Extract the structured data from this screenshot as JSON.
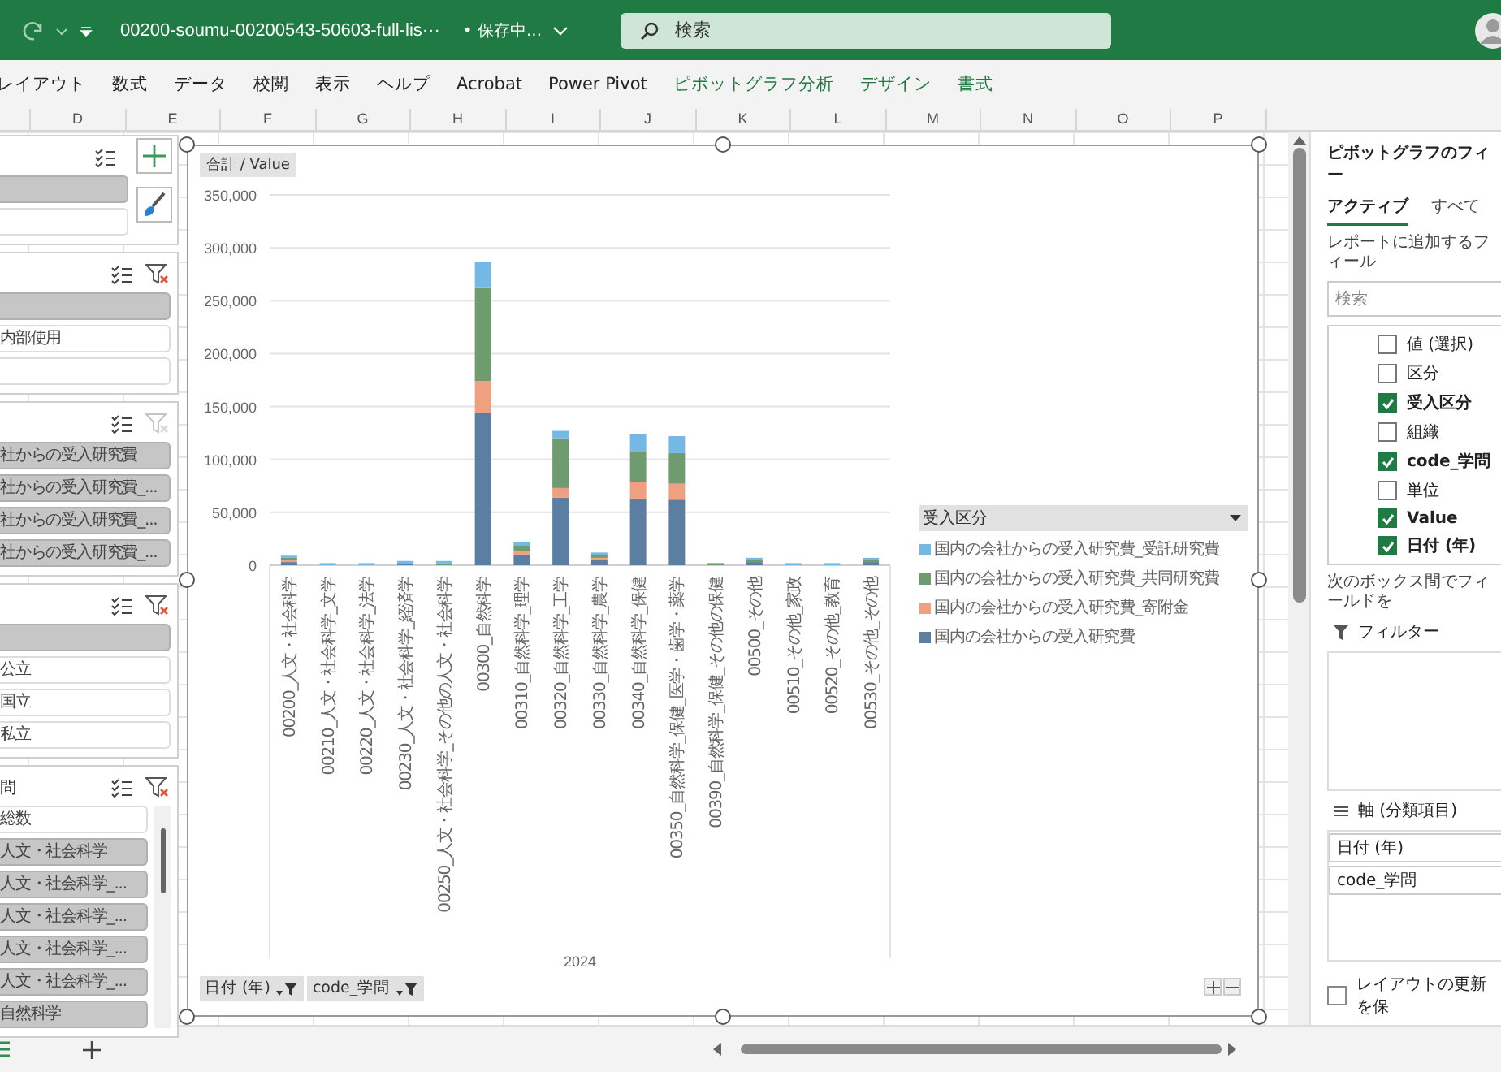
{
  "title_bar": {
    "file_name": "00200-soumu-00200543-50603-full-lis···",
    "save_status": "• 保存中...",
    "search_placeholder": "検索"
  },
  "ribbon_tabs": [
    {
      "label": "レイアウト",
      "kind": "normal"
    },
    {
      "label": "数式",
      "kind": "normal"
    },
    {
      "label": "データ",
      "kind": "normal"
    },
    {
      "label": "校閲",
      "kind": "normal"
    },
    {
      "label": "表示",
      "kind": "normal"
    },
    {
      "label": "ヘルプ",
      "kind": "normal"
    },
    {
      "label": "Acrobat",
      "kind": "normal"
    },
    {
      "label": "Power Pivot",
      "kind": "normal"
    },
    {
      "label": "ピボットグラフ分析",
      "kind": "contextual"
    },
    {
      "label": "デザイン",
      "kind": "contextual"
    },
    {
      "label": "書式",
      "kind": "contextual"
    }
  ],
  "columns": [
    "D",
    "E",
    "F",
    "G",
    "H",
    "I",
    "J",
    "K",
    "L",
    "M",
    "N",
    "O",
    "P"
  ],
  "slicers": [
    {
      "kind": "tools",
      "items": [
        {
          "selected": true
        },
        {
          "selected": false
        }
      ]
    },
    {
      "kind": "plain",
      "filter_active": true,
      "items": [
        {
          "selected": true
        },
        {
          "label": "内部使用",
          "selected": false
        },
        {
          "selected": false
        }
      ]
    },
    {
      "kind": "plain",
      "filter_active": false,
      "items": [
        {
          "label": "社からの受入研究費",
          "selected": true
        },
        {
          "label": "社からの受入研究費_...",
          "selected": true
        },
        {
          "label": "社からの受入研究費_...",
          "selected": true
        },
        {
          "label": "社からの受入研究費_...",
          "selected": true
        }
      ]
    },
    {
      "kind": "plain",
      "filter_active": true,
      "items": [
        {
          "selected": true
        },
        {
          "label": "公立",
          "selected": false
        },
        {
          "label": "国立",
          "selected": false
        },
        {
          "label": "私立",
          "selected": false
        }
      ]
    },
    {
      "kind": "scroll",
      "header": "問",
      "filter_active": true,
      "items": [
        {
          "label": "総数",
          "selected": false
        },
        {
          "label": "人文・社会科学",
          "selected": true
        },
        {
          "label": "人文・社会科学_...",
          "selected": true
        },
        {
          "label": "人文・社会科学_...",
          "selected": true
        },
        {
          "label": "人文・社会科学_...",
          "selected": true
        },
        {
          "label": "人文・社会科学_...",
          "selected": true
        },
        {
          "label": "自然科学",
          "selected": true
        }
      ]
    }
  ],
  "pivot_chart": {
    "value_field_button": "合計 / Value",
    "legend_title": "受入区分",
    "axis_field_buttons": [
      "日付 (年)",
      "code_学問"
    ],
    "chart_data": {
      "type": "bar",
      "stacked": true,
      "orientation": "vertical",
      "grid": true,
      "legend": true,
      "xlabel": "2024",
      "categories": [
        "00200_人文・社会科学",
        "00210_人文・社会科学_文学",
        "00220_人文・社会科学_法学",
        "00230_人文・社会科学_経済学",
        "00250_人文・社会科学_その他の人文・社会科学",
        "00300_自然科学",
        "00310_自然科学_理学",
        "00320_自然科学_工学",
        "00330_自然科学_農学",
        "00340_自然科学_保健",
        "00350_自然科学_保健_医学・歯学・薬学",
        "00390_自然科学_保健_その他の保健",
        "00500_その他",
        "00510_その他_家政",
        "00520_その他_教育",
        "00530_その他_その他"
      ],
      "series": [
        {
          "name": "国内の会社からの受入研究費",
          "color": "#5b7fa3",
          "values": [
            3000,
            0,
            0,
            2000,
            0,
            144000,
            10000,
            64000,
            5000,
            63000,
            62000,
            0,
            3000,
            0,
            0,
            3000
          ]
        },
        {
          "name": "国内の会社からの受入研究費_寄附金",
          "color": "#f0a080",
          "values": [
            2000,
            0,
            0,
            0,
            0,
            30000,
            3000,
            9000,
            2000,
            16000,
            15000,
            0,
            0,
            0,
            0,
            0
          ]
        },
        {
          "name": "国内の会社からの受入研究費_共同研究費",
          "color": "#6e9c6e",
          "values": [
            2000,
            0,
            0,
            0,
            2000,
            88000,
            6000,
            47000,
            3000,
            29000,
            29000,
            2000,
            2000,
            0,
            0,
            2000
          ]
        },
        {
          "name": "国内の会社からの受入研究費_受託研究費",
          "color": "#74b8e6",
          "values": [
            2000,
            2000,
            2000,
            2000,
            2000,
            25000,
            3000,
            7000,
            2000,
            16000,
            16000,
            0,
            2000,
            2000,
            2000,
            2000
          ]
        }
      ],
      "ylim": [
        0,
        350000
      ],
      "yticks": [
        {
          "value": 0,
          "label": "0"
        },
        {
          "value": 50000,
          "label": "50,000"
        },
        {
          "value": 100000,
          "label": "100,000"
        },
        {
          "value": 150000,
          "label": "150,000"
        },
        {
          "value": 200000,
          "label": "200,000"
        },
        {
          "value": 250000,
          "label": "250,000"
        },
        {
          "value": 300000,
          "label": "300,000"
        },
        {
          "value": 350000,
          "label": "350,000"
        }
      ]
    }
  },
  "field_pane": {
    "title": "ピボットグラフのフィー",
    "tabs": [
      {
        "label": "アクティブ",
        "selected": true
      },
      {
        "label": "すべて",
        "selected": false
      }
    ],
    "instruction": "レポートに追加するフィール",
    "search_placeholder": "検索",
    "fields": [
      {
        "label": "値 (選択)",
        "checked": false
      },
      {
        "label": "区分",
        "checked": false
      },
      {
        "label": "受入区分",
        "checked": true
      },
      {
        "label": "組織",
        "checked": false
      },
      {
        "label": "code_学問",
        "checked": true
      },
      {
        "label": "単位",
        "checked": false
      },
      {
        "label": "Value",
        "checked": true
      },
      {
        "label": "日付 (年)",
        "checked": true
      }
    ],
    "areas_hint": "次のボックス間でフィールドを",
    "filter_area": "フィルター",
    "axis_area": {
      "label": "軸 (分類項目)",
      "items": [
        "日付 (年)",
        "code_学問"
      ]
    },
    "defer_update": {
      "label": "レイアウトの更新を保",
      "checked": false
    }
  }
}
